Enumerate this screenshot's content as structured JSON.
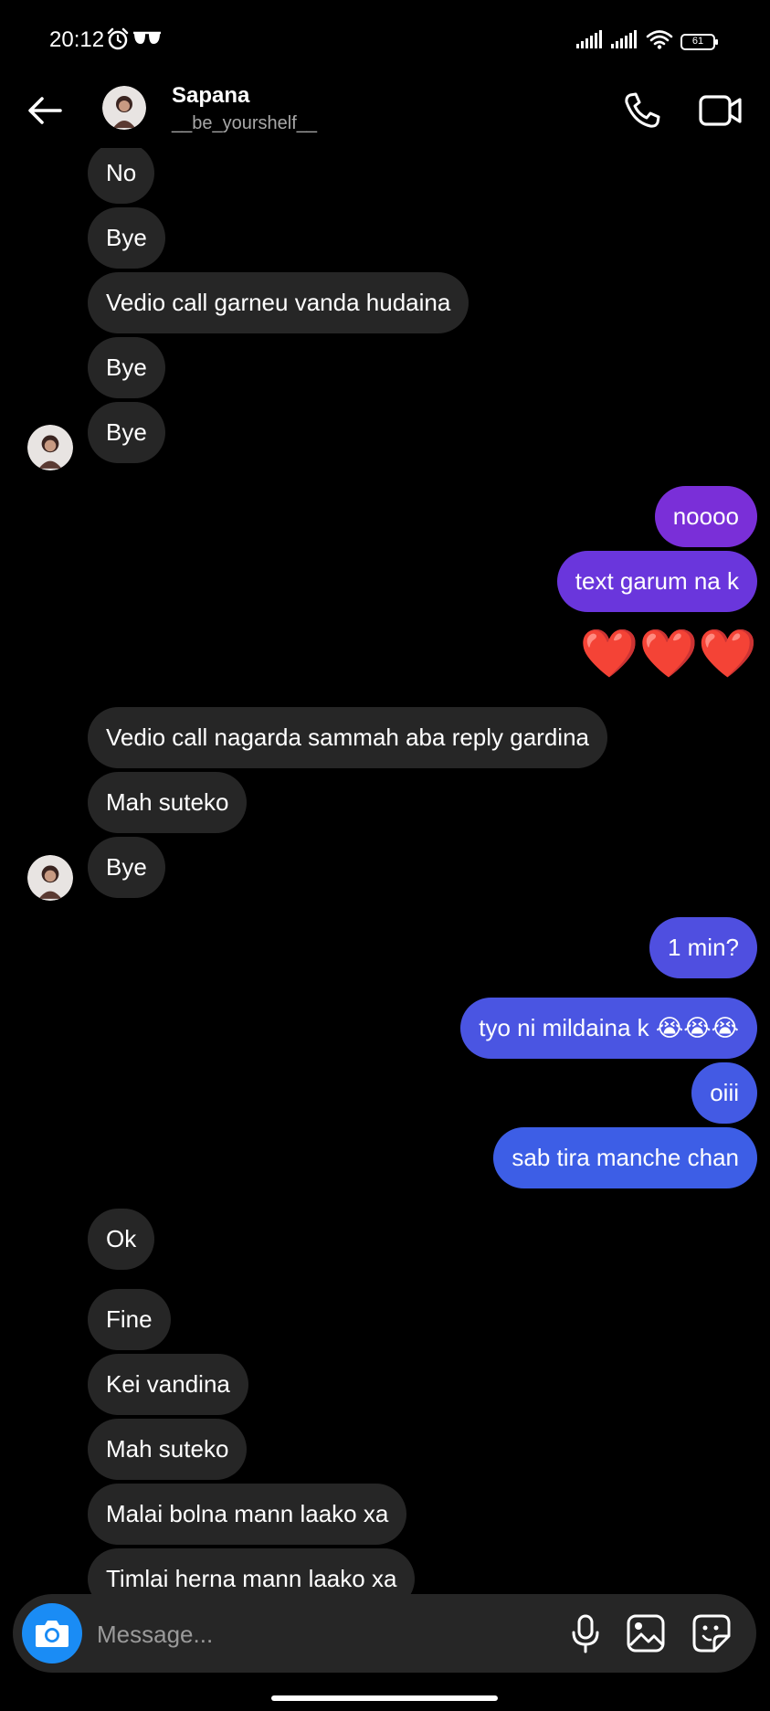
{
  "status_bar": {
    "time": "20:12",
    "battery": "61"
  },
  "header": {
    "name": "Sapana",
    "username": "__be_yourshelf__"
  },
  "messages": [
    {
      "side": "in",
      "text": "No"
    },
    {
      "side": "in",
      "text": "Bye"
    },
    {
      "side": "in",
      "text": "Vedio call garneu vanda hudaina"
    },
    {
      "side": "in",
      "text": "Bye"
    },
    {
      "side": "in",
      "text": "Bye"
    },
    {
      "side": "out",
      "text": "noooo"
    },
    {
      "side": "out",
      "text": "text garum na k"
    },
    {
      "side": "out",
      "text": "❤️❤️❤️"
    },
    {
      "side": "in",
      "text": "Vedio call nagarda sammah aba reply gardina"
    },
    {
      "side": "in",
      "text": "Mah suteko"
    },
    {
      "side": "in",
      "text": "Bye"
    },
    {
      "side": "out",
      "text": "1 min?"
    },
    {
      "side": "out",
      "text": "tyo ni mildaina k 😭😭😭"
    },
    {
      "side": "out",
      "text": "oiii"
    },
    {
      "side": "out",
      "text": "sab tira manche chan"
    },
    {
      "side": "in",
      "text": "Ok"
    },
    {
      "side": "in",
      "text": "Fine"
    },
    {
      "side": "in",
      "text": "Kei vandina"
    },
    {
      "side": "in",
      "text": "Mah suteko"
    },
    {
      "side": "in",
      "text": "Malai bolna mann laako xa"
    },
    {
      "side": "in",
      "text": "Timlai herna mann laako xa"
    }
  ],
  "composer": {
    "placeholder": "Message..."
  },
  "colors": {
    "incoming_bubble": "#262626",
    "outgoing_purple": "#7a2fd8",
    "outgoing_violet": "#6a36dc",
    "outgoing_indigo": "#4f4fe0",
    "outgoing_blue": "#3d5ee6",
    "camera_button": "#1a8cf5"
  }
}
